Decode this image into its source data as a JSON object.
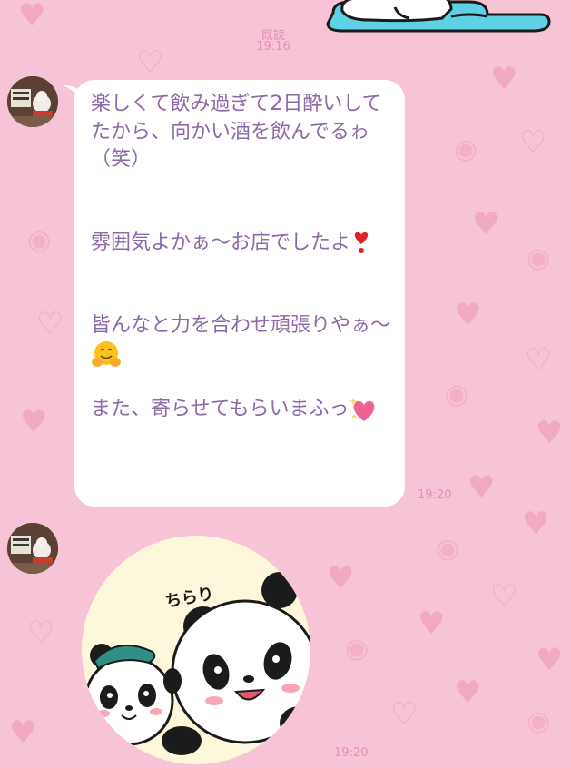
{
  "chat": {
    "top_message": {
      "read_label": "既読",
      "time": "19:16",
      "sticker": "cat-sticker-cropped"
    },
    "received_text": {
      "avatar": "contact-avatar",
      "text": "楽しくて飲み過ぎて2日酔いしてたから、向かい酒を飲んでるゎ（笑）\n\n\n雰囲気よかぁ～お店でしたよ",
      "text_2": "\n\n\n皆んなと力を合わせ頑張りやぁ～",
      "text_3": "\n\nまた、寄らせてもらいまふっ",
      "emojis": [
        "heart-exclamation-emoji",
        "hugging-face-emoji",
        "sparkling-heart-emoji"
      ],
      "time": "19:20"
    },
    "received_sticker": {
      "avatar": "contact-avatar",
      "sticker_text": "ちらり",
      "sticker": "panda-sticker",
      "time": "19:20"
    }
  },
  "colors": {
    "background": "#f7c3d6",
    "pattern": "#f2a9c3",
    "message_text": "#8c6aa8",
    "meta_text": "#e591b3",
    "bubble": "#ffffff"
  }
}
